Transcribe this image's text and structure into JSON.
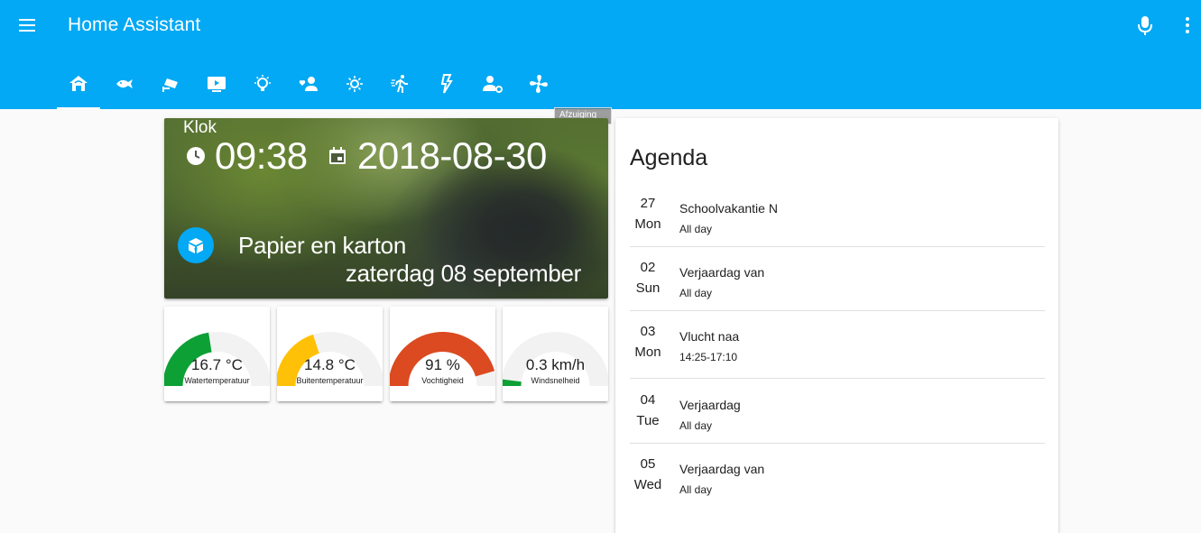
{
  "app": {
    "title": "Home Assistant"
  },
  "header": {
    "menu_icon": "menu-icon",
    "mic_icon": "microphone-icon",
    "more_icon": "dots-vertical-icon",
    "tabs": [
      {
        "icon": "home-icon"
      },
      {
        "icon": "fish-icon"
      },
      {
        "icon": "cctv-icon"
      },
      {
        "icon": "television-play-icon"
      },
      {
        "icon": "lightbulb-on-icon"
      },
      {
        "icon": "account-heart-icon"
      },
      {
        "icon": "brightness-icon"
      },
      {
        "icon": "run-icon"
      },
      {
        "icon": "flash-icon"
      },
      {
        "icon": "account-settings-icon"
      },
      {
        "icon": "fan-icon"
      }
    ],
    "active_tab_index": 0,
    "tooltip": "Afzuiging"
  },
  "picture_card": {
    "title": "Klok",
    "time": "09:38",
    "date": "2018-08-30",
    "waste_type": "Papier en karton",
    "waste_date": "zaterdag 08 september"
  },
  "gauges": [
    {
      "value": "16.7 °C",
      "label": "Watertemperatuur",
      "fraction": 0.45,
      "color": "#0da035"
    },
    {
      "value": "14.8 °C",
      "label": "Buitentemperatuur",
      "fraction": 0.4,
      "color": "#ffc107"
    },
    {
      "value": "91 %",
      "label": "Vochtigheid",
      "fraction": 0.91,
      "color": "#db4a20"
    },
    {
      "value": "0.3 km/h",
      "label": "Windsnelheid",
      "fraction": 0.04,
      "color": "#0da035"
    }
  ],
  "agenda": {
    "title": "Agenda",
    "events": [
      {
        "day": "27",
        "dow": "Mon",
        "summary": "Schoolvakantie N",
        "time": "All day"
      },
      {
        "day": "02",
        "dow": "Sun",
        "summary": "Verjaardag van",
        "time": "All day"
      },
      {
        "day": "03",
        "dow": "Mon",
        "summary": "Vlucht naa",
        "time": "14:25-17:10"
      },
      {
        "day": "04",
        "dow": "Tue",
        "summary": "Verjaardag",
        "time": "All day"
      },
      {
        "day": "05",
        "dow": "Wed",
        "summary": "Verjaardag van",
        "time": "All day"
      }
    ]
  },
  "colors": {
    "primary": "#03a9f4",
    "background": "#fafafa",
    "gauge_track": "#f2f2f2"
  }
}
